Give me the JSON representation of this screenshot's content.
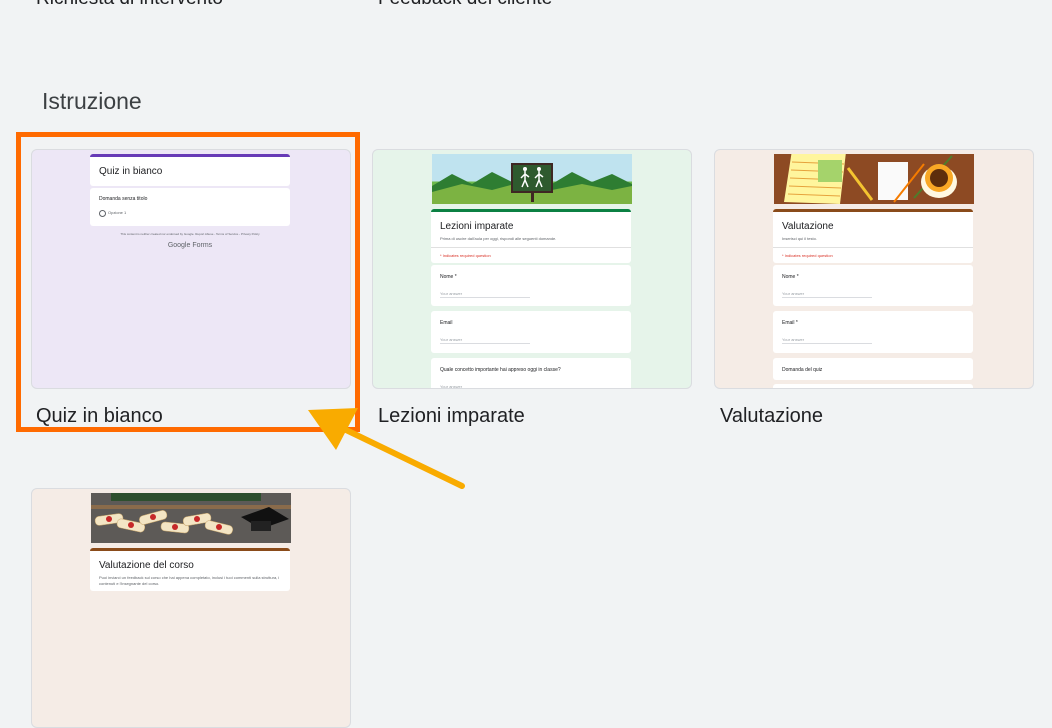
{
  "top_labels": [
    "Richiesta di intervento",
    "Feedback del cliente"
  ],
  "section": {
    "title": "Istruzione"
  },
  "templates": [
    {
      "name": "Quiz in bianco",
      "preview": {
        "form_title": "Quiz in bianco",
        "question": "Domanda senza titolo",
        "option": "Opzione 1",
        "footer": "This content is neither created nor endorsed by Google. Report Abuse - Terms of Service - Privacy Policy",
        "brand": "Google Forms"
      }
    },
    {
      "name": "Lezioni imparate",
      "preview": {
        "form_title": "Lezioni imparate",
        "description": "Prima di uscire dall'aula per oggi, rispondi alle seguenti domande.",
        "required_note": "* Indicates required question",
        "fields": [
          {
            "label": "Nome *",
            "answer": "Your answer"
          },
          {
            "label": "Email",
            "answer": "Your answer"
          },
          {
            "label": "Quale concetto importante hai appreso oggi in classe?",
            "answer": "Your answer"
          }
        ]
      }
    },
    {
      "name": "Valutazione",
      "preview": {
        "form_title": "Valutazione",
        "description": "Inserisci qui il testo.",
        "required_note": "* Indicates required question",
        "fields": [
          {
            "label": "Nome *",
            "answer": "Your answer"
          },
          {
            "label": "Email *",
            "answer": "Your answer"
          },
          {
            "label": "Domanda del quiz",
            "answer": ""
          }
        ]
      }
    },
    {
      "name": "Valutazione del corso",
      "preview": {
        "form_title": "Valutazione del corso",
        "description": "Puoi inviarci un feedback sul corso che hai appena completato, inclusi i tuoi commenti sulla struttura, i contenuti e l'insegnante del corso."
      }
    }
  ],
  "colors": {
    "highlight": "#ff6a00",
    "arrow": "#f9ab00",
    "quiz_accent": "#673ab7",
    "lessons_accent": "#0b8043",
    "eval_accent": "#8a4b1a"
  }
}
